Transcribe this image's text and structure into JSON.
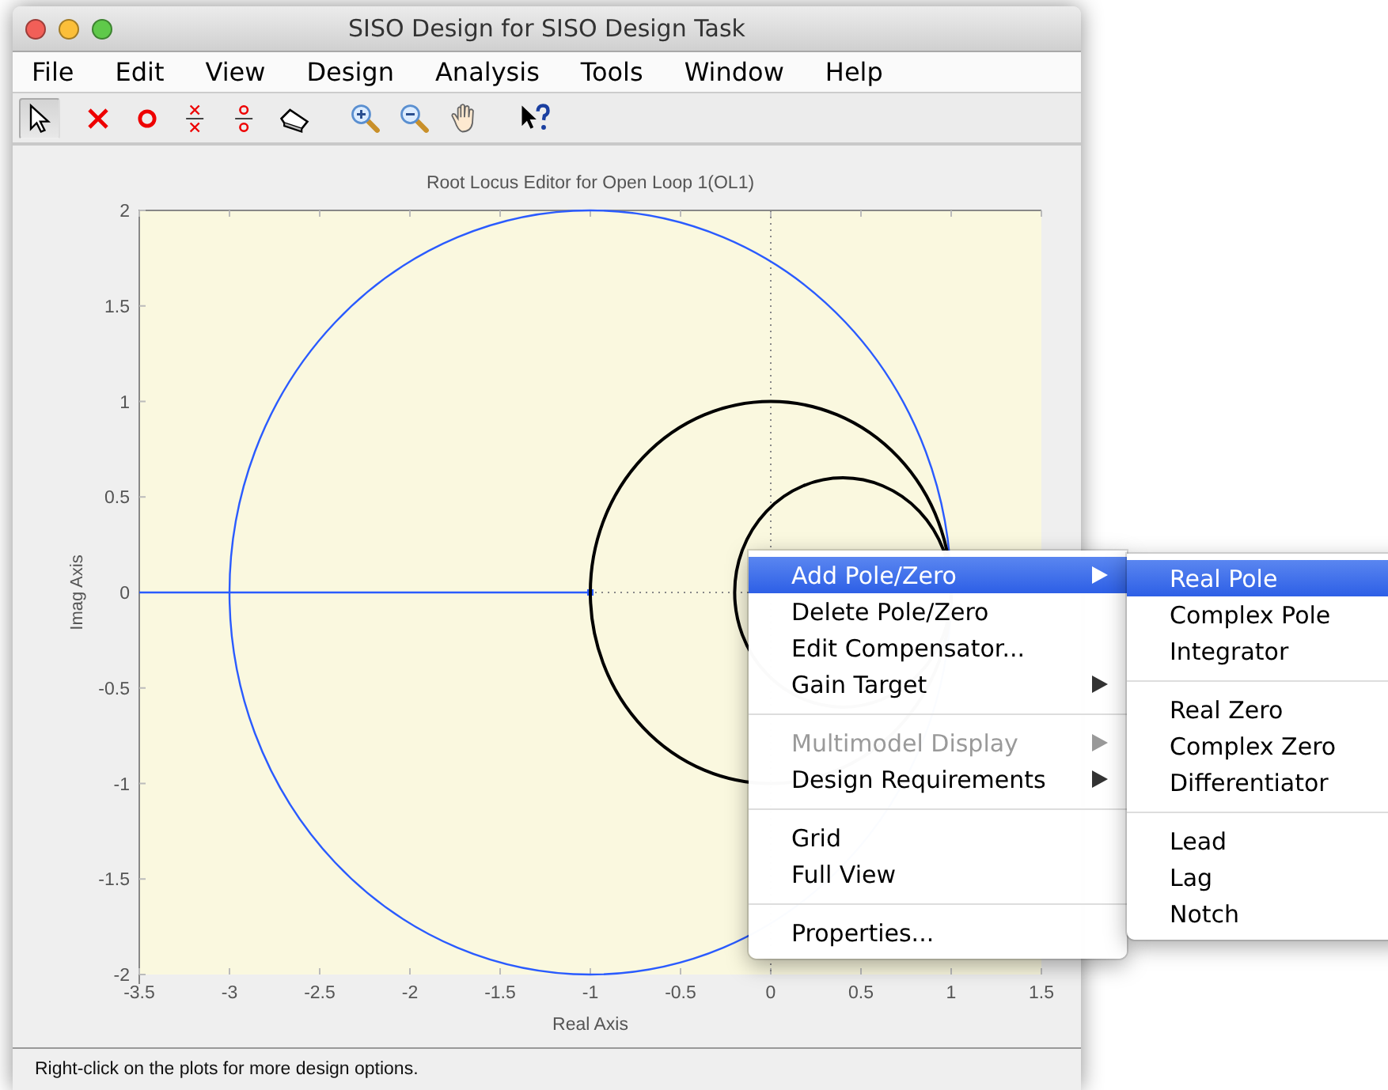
{
  "window": {
    "title": "SISO Design for SISO Design Task"
  },
  "menu_bar": [
    "File",
    "Edit",
    "View",
    "Design",
    "Analysis",
    "Tools",
    "Window",
    "Help"
  ],
  "toolbar": [
    {
      "kind": "pointer",
      "selected": true
    },
    {
      "kind": "pole",
      "selected": false
    },
    {
      "kind": "zero",
      "selected": false
    },
    {
      "kind": "complex-pole",
      "selected": false
    },
    {
      "kind": "complex-zero",
      "selected": false
    },
    {
      "kind": "eraser",
      "selected": false
    },
    {
      "kind": "zoom-in",
      "selected": false
    },
    {
      "kind": "zoom-out",
      "selected": false
    },
    {
      "kind": "pan",
      "selected": false
    },
    {
      "kind": "help",
      "selected": false
    }
  ],
  "plot": {
    "title": "Root Locus Editor for Open Loop 1(OL1)",
    "xlabel": "Real Axis",
    "ylabel": "Imag Axis",
    "x_ticks": [
      "-3.5",
      "-3",
      "-2.5",
      "-2",
      "-1.5",
      "-1",
      "-0.5",
      "0",
      "0.5",
      "1",
      "1.5"
    ],
    "y_ticks": [
      "2",
      "1.5",
      "1",
      "0.5",
      "0",
      "-0.5",
      "-1",
      "-1.5",
      "-2"
    ]
  },
  "context_menu": {
    "groups": [
      {
        "items": [
          {
            "label": "Add Pole/Zero",
            "submenu": true,
            "selected": true,
            "disabled": false
          },
          {
            "label": "Delete Pole/Zero",
            "submenu": false,
            "selected": false,
            "disabled": false
          },
          {
            "label": "Edit Compensator...",
            "submenu": false,
            "selected": false,
            "disabled": false
          },
          {
            "label": "Gain Target",
            "submenu": true,
            "selected": false,
            "disabled": false
          }
        ]
      },
      {
        "items": [
          {
            "label": "Multimodel Display",
            "submenu": true,
            "selected": false,
            "disabled": true
          },
          {
            "label": "Design Requirements",
            "submenu": true,
            "selected": false,
            "disabled": false
          }
        ]
      },
      {
        "items": [
          {
            "label": "Grid",
            "submenu": false,
            "selected": false,
            "disabled": false
          },
          {
            "label": "Full View",
            "submenu": false,
            "selected": false,
            "disabled": false
          }
        ]
      },
      {
        "items": [
          {
            "label": "Properties...",
            "submenu": false,
            "selected": false,
            "disabled": false
          }
        ]
      }
    ]
  },
  "submenu": {
    "groups": [
      {
        "items": [
          {
            "label": "Real Pole",
            "selected": true
          },
          {
            "label": "Complex Pole",
            "selected": false
          },
          {
            "label": "Integrator",
            "selected": false
          }
        ]
      },
      {
        "items": [
          {
            "label": "Real Zero",
            "selected": false
          },
          {
            "label": "Complex Zero",
            "selected": false
          },
          {
            "label": "Differentiator",
            "selected": false
          }
        ]
      },
      {
        "items": [
          {
            "label": "Lead",
            "selected": false
          },
          {
            "label": "Lag",
            "selected": false
          },
          {
            "label": "Notch",
            "selected": false
          }
        ]
      }
    ]
  },
  "status_bar": "Right-click on the plots for more design options."
}
